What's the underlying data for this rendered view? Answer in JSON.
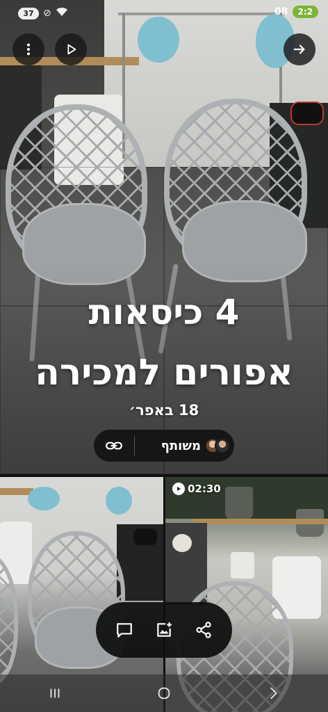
{
  "status_bar": {
    "battery": "37",
    "clock": "08",
    "time_pill": "2:2"
  },
  "top_controls": {
    "more_icon": "more-vert-icon",
    "play_icon": "play-icon",
    "forward_icon": "arrow-right-icon"
  },
  "album": {
    "title_line1": "4 כיסאות",
    "title_line2": "אפורים למכירה",
    "date": "18 באפר׳",
    "shared_label": "משותף",
    "link_icon": "link-icon"
  },
  "thumbnails": {
    "video_duration": "02:30"
  },
  "actions": {
    "comment_icon": "comment-icon",
    "add_photo_icon": "add-photo-icon",
    "share_icon": "share-icon"
  },
  "navbar": {
    "recents_icon": "recents-icon",
    "home_icon": "home-icon",
    "back_icon": "back-icon"
  },
  "colors": {
    "overlay": "#181818",
    "text": "#ffffff",
    "time_pill": "#7ab53a"
  }
}
